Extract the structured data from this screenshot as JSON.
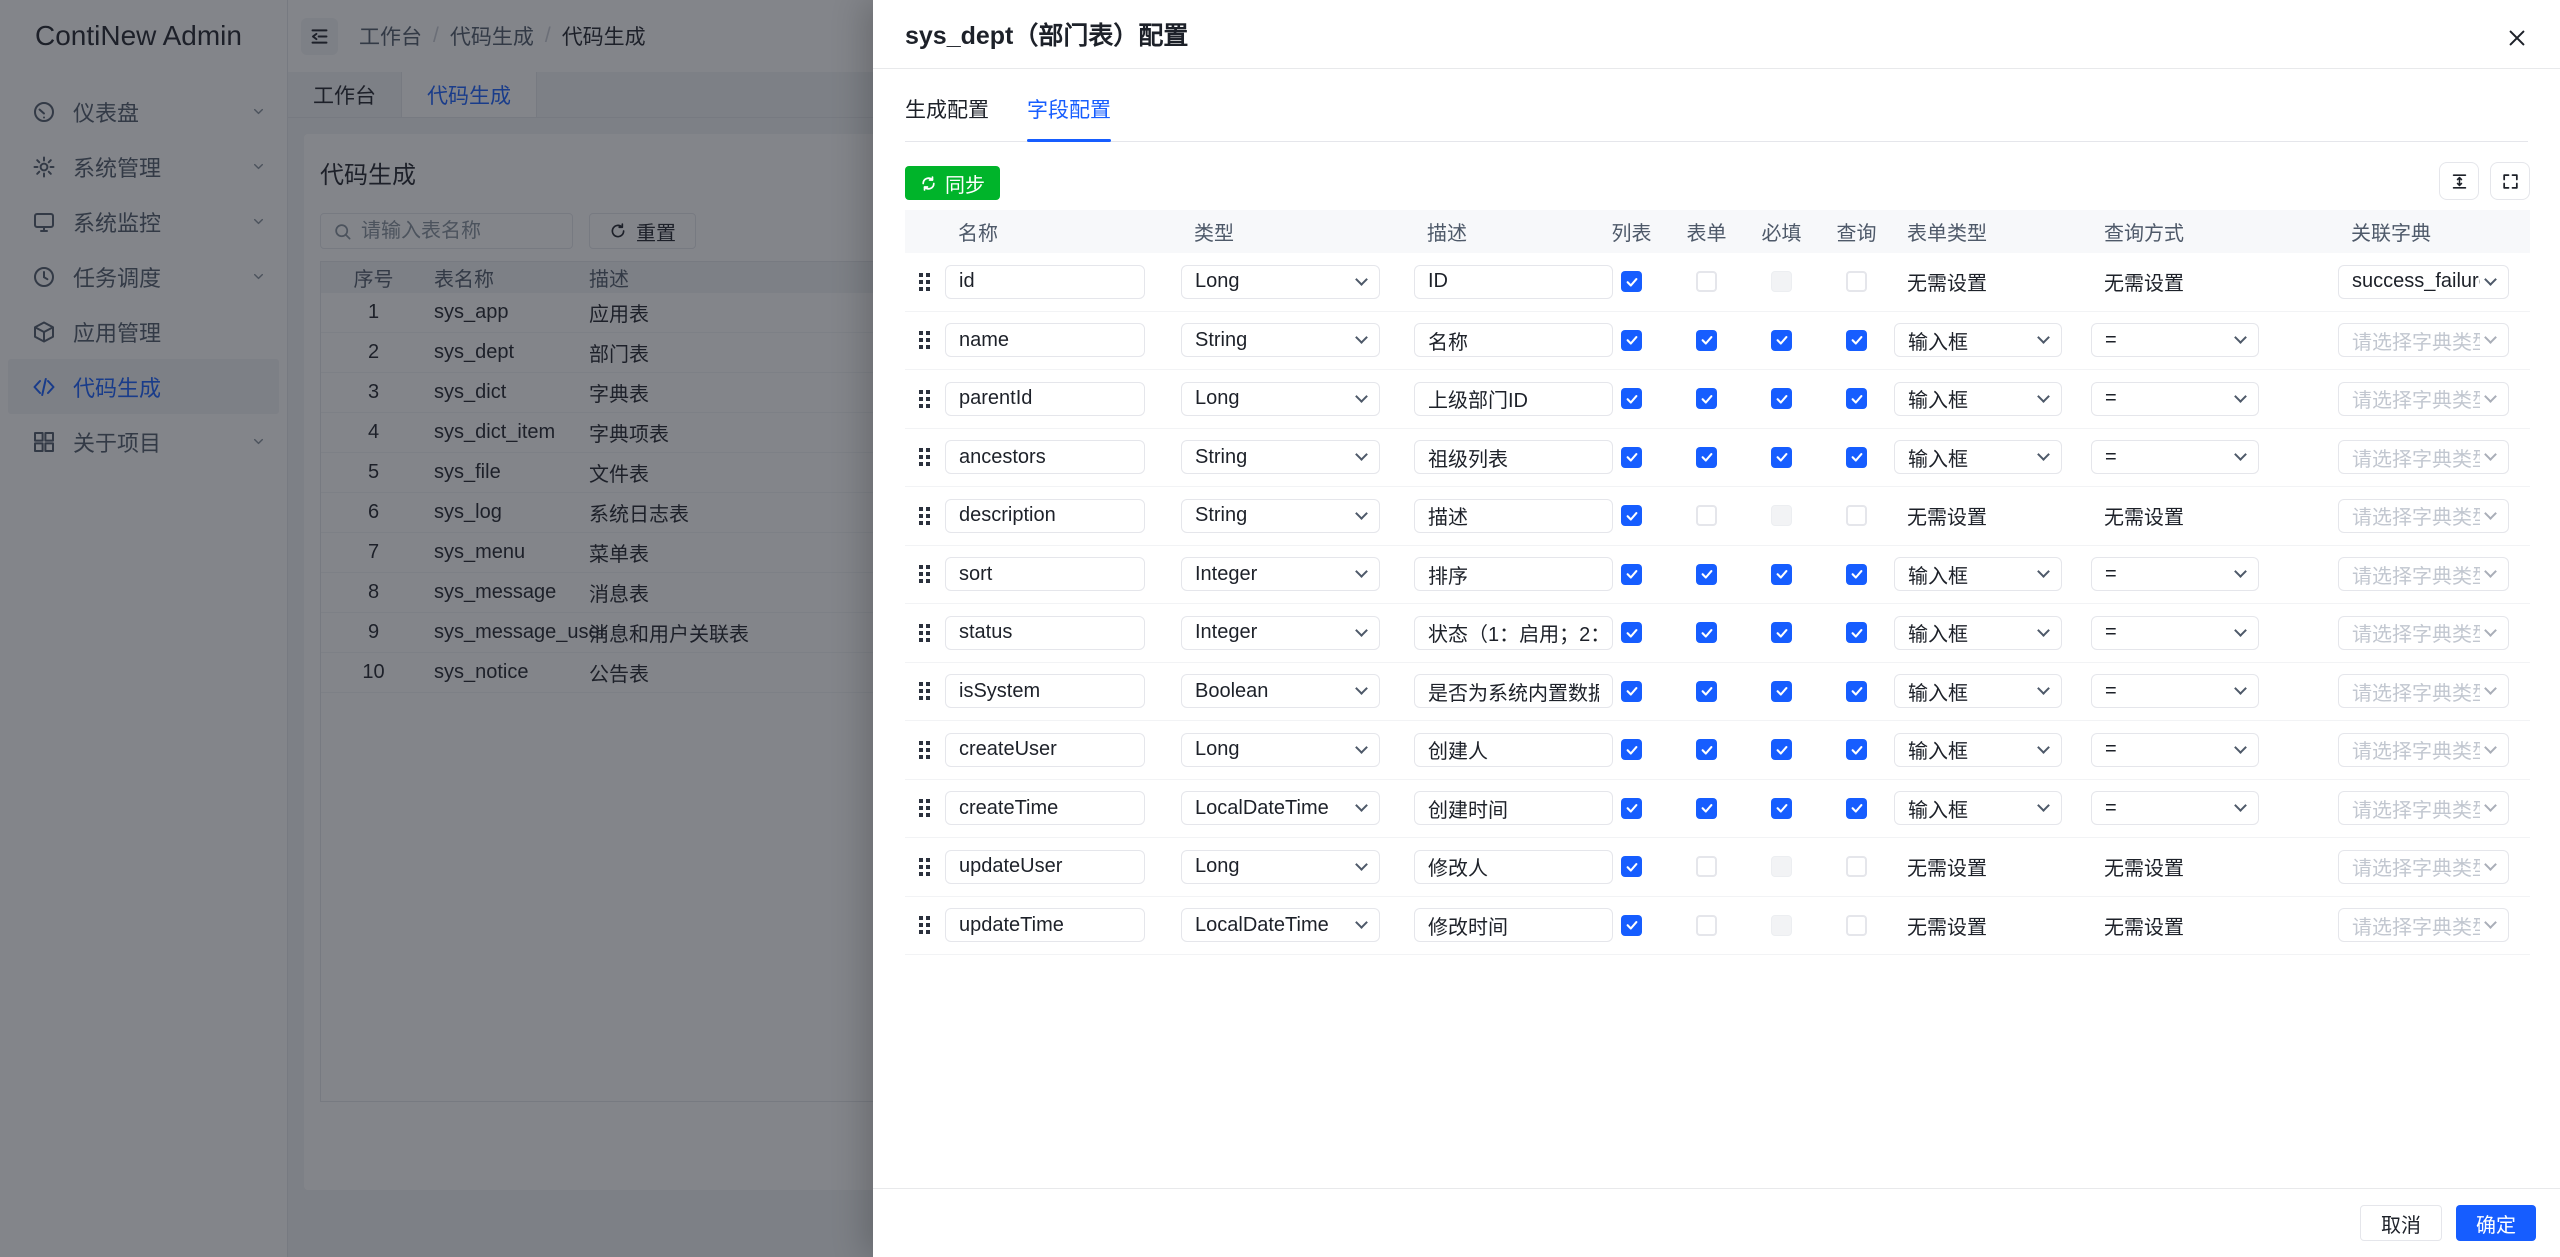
{
  "colors": {
    "primary": "#165dff",
    "success": "#00b42a",
    "text": "#1d2129",
    "mask": "rgba(29,33,41,0.55)"
  },
  "sidebar": {
    "logo_text": "ContiNew Admin",
    "items": [
      {
        "label": "仪表盘",
        "icon": "dashboard-icon",
        "chevron": true,
        "active": false
      },
      {
        "label": "系统管理",
        "icon": "settings-icon",
        "chevron": true,
        "active": false
      },
      {
        "label": "系统监控",
        "icon": "monitor-icon",
        "chevron": true,
        "active": false
      },
      {
        "label": "任务调度",
        "icon": "clock-icon",
        "chevron": true,
        "active": false
      },
      {
        "label": "应用管理",
        "icon": "cube-icon",
        "chevron": false,
        "active": false
      },
      {
        "label": "代码生成",
        "icon": "code-icon",
        "chevron": false,
        "active": true
      },
      {
        "label": "关于项目",
        "icon": "grid-icon",
        "chevron": true,
        "active": false
      }
    ]
  },
  "topbar": {
    "breadcrumb": [
      "工作台",
      "代码生成",
      "代码生成"
    ]
  },
  "tabbar": {
    "tabs": [
      {
        "label": "工作台",
        "active": false
      },
      {
        "label": "代码生成",
        "active": true
      }
    ]
  },
  "page": {
    "title": "代码生成",
    "search_placeholder": "请输入表名称",
    "reset_label": "重置",
    "table": {
      "columns": [
        "序号",
        "表名称",
        "描述"
      ],
      "rows": [
        {
          "index": "1",
          "name": "sys_app",
          "desc": "应用表"
        },
        {
          "index": "2",
          "name": "sys_dept",
          "desc": "部门表"
        },
        {
          "index": "3",
          "name": "sys_dict",
          "desc": "字典表"
        },
        {
          "index": "4",
          "name": "sys_dict_item",
          "desc": "字典项表"
        },
        {
          "index": "5",
          "name": "sys_file",
          "desc": "文件表"
        },
        {
          "index": "6",
          "name": "sys_log",
          "desc": "系统日志表"
        },
        {
          "index": "7",
          "name": "sys_menu",
          "desc": "菜单表"
        },
        {
          "index": "8",
          "name": "sys_message",
          "desc": "消息表"
        },
        {
          "index": "9",
          "name": "sys_message_user",
          "desc": "消息和用户关联表"
        },
        {
          "index": "10",
          "name": "sys_notice",
          "desc": "公告表"
        }
      ]
    }
  },
  "drawer": {
    "title": "sys_dept（部门表）配置",
    "tabs": [
      {
        "label": "生成配置",
        "active": false
      },
      {
        "label": "字段配置",
        "active": true
      }
    ],
    "sync_label": "同步",
    "field_table": {
      "columns": [
        "名称",
        "类型",
        "描述",
        "列表",
        "表单",
        "必填",
        "查询",
        "表单类型",
        "查询方式",
        "关联字典"
      ],
      "none_label": "无需设置",
      "dict_placeholder": "请选择字典类型",
      "rows": [
        {
          "name": "id",
          "type": "Long",
          "desc": "ID",
          "list": "checked",
          "form": "unchecked",
          "required": "disabled",
          "query": "unchecked",
          "form_type": null,
          "query_type": null,
          "dict": "success_failure"
        },
        {
          "name": "name",
          "type": "String",
          "desc": "名称",
          "list": "checked",
          "form": "checked",
          "required": "checked",
          "query": "checked",
          "form_type": "输入框",
          "query_type": "=",
          "dict": null
        },
        {
          "name": "parentId",
          "type": "Long",
          "desc": "上级部门ID",
          "list": "checked",
          "form": "checked",
          "required": "checked",
          "query": "checked",
          "form_type": "输入框",
          "query_type": "=",
          "dict": null
        },
        {
          "name": "ancestors",
          "type": "String",
          "desc": "祖级列表",
          "list": "checked",
          "form": "checked",
          "required": "checked",
          "query": "checked",
          "form_type": "输入框",
          "query_type": "=",
          "dict": null
        },
        {
          "name": "description",
          "type": "String",
          "desc": "描述",
          "list": "checked",
          "form": "unchecked",
          "required": "disabled",
          "query": "unchecked",
          "form_type": null,
          "query_type": null,
          "dict": null
        },
        {
          "name": "sort",
          "type": "Integer",
          "desc": "排序",
          "list": "checked",
          "form": "checked",
          "required": "checked",
          "query": "checked",
          "form_type": "输入框",
          "query_type": "=",
          "dict": null
        },
        {
          "name": "status",
          "type": "Integer",
          "desc": "状态（1：启用；2：",
          "list": "checked",
          "form": "checked",
          "required": "checked",
          "query": "checked",
          "form_type": "输入框",
          "query_type": "=",
          "dict": null
        },
        {
          "name": "isSystem",
          "type": "Boolean",
          "desc": "是否为系统内置数据",
          "list": "checked",
          "form": "checked",
          "required": "checked",
          "query": "checked",
          "form_type": "输入框",
          "query_type": "=",
          "dict": null
        },
        {
          "name": "createUser",
          "type": "Long",
          "desc": "创建人",
          "list": "checked",
          "form": "checked",
          "required": "checked",
          "query": "checked",
          "form_type": "输入框",
          "query_type": "=",
          "dict": null
        },
        {
          "name": "createTime",
          "type": "LocalDateTime",
          "desc": "创建时间",
          "list": "checked",
          "form": "checked",
          "required": "checked",
          "query": "checked",
          "form_type": "输入框",
          "query_type": "=",
          "dict": null
        },
        {
          "name": "updateUser",
          "type": "Long",
          "desc": "修改人",
          "list": "checked",
          "form": "unchecked",
          "required": "disabled",
          "query": "unchecked",
          "form_type": null,
          "query_type": null,
          "dict": null
        },
        {
          "name": "updateTime",
          "type": "LocalDateTime",
          "desc": "修改时间",
          "list": "checked",
          "form": "unchecked",
          "required": "disabled",
          "query": "unchecked",
          "form_type": null,
          "query_type": null,
          "dict": null
        }
      ]
    },
    "footer": {
      "cancel_label": "取消",
      "ok_label": "确定"
    }
  }
}
